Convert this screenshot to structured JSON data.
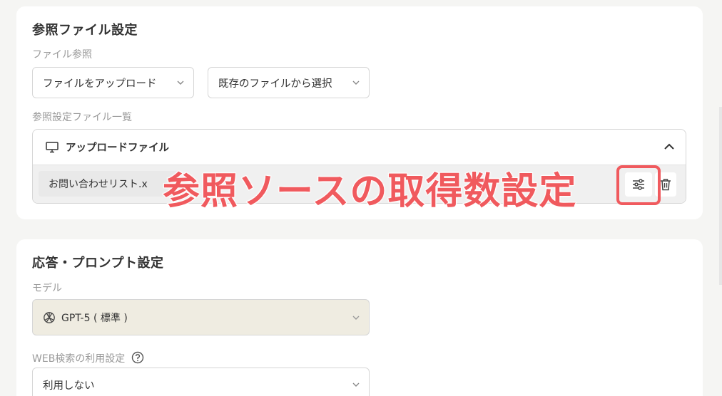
{
  "reference_section": {
    "title": "参照ファイル設定",
    "file_ref_label": "ファイル参照",
    "upload_select": "ファイルをアップロード",
    "existing_select": "既存のファイルから選択",
    "list_label": "参照設定ファイル一覧",
    "upload_header": "アップロードファイル",
    "file_name": "お問い合わせリスト.x"
  },
  "annotation": {
    "text": "参照ソースの取得数設定",
    "color": "#f05a5e"
  },
  "response_section": {
    "title": "応答・プロンプト設定",
    "model_label": "モデル",
    "model_value": "GPT-5 ( 標準 )",
    "web_search_label": "WEB検索の利用設定",
    "web_search_value": "利用しない"
  },
  "icons": {
    "monitor": "monitor-icon",
    "settings": "sliders-icon",
    "trash": "trash-icon",
    "help": "question-circle-icon",
    "model": "openai-logo-icon"
  }
}
